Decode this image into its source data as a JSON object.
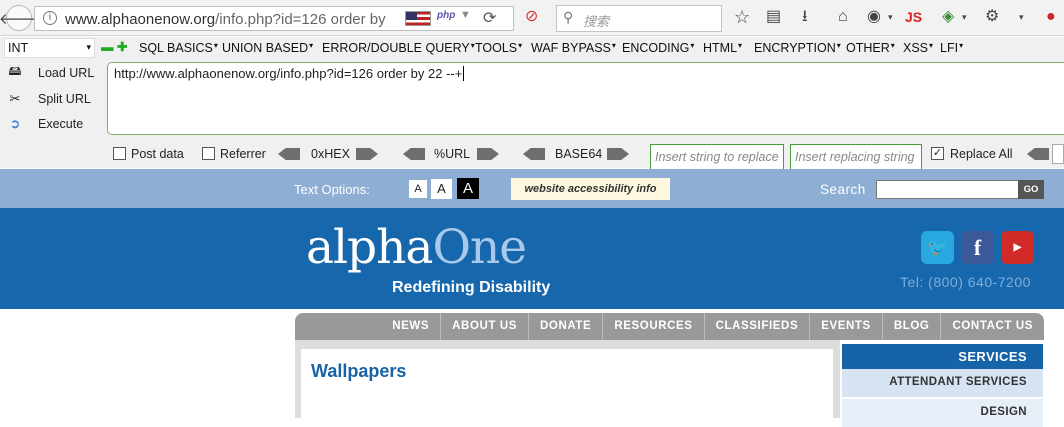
{
  "browser": {
    "url_domain": "www.alphaonenow.org",
    "url_rest": "/info.php?id=126 order by",
    "search_placeholder": "搜索",
    "js_label": "JS"
  },
  "hackbar": {
    "int_select": "INT",
    "menus": [
      "SQL BASICS",
      "UNION BASED",
      "ERROR/DOUBLE QUERY",
      "TOOLS",
      "WAF BYPASS",
      "ENCODING",
      "HTML",
      "ENCRYPTION",
      "OTHER",
      "XSS",
      "LFI"
    ],
    "load_url": "Load URL",
    "split_url": "Split URL",
    "execute": "Execute",
    "url_value": "http://www.alphaonenow.org/info.php?id=126 order by 22 --+",
    "post_data": "Post data",
    "referrer": "Referrer",
    "hex": "0xHEX",
    "url_enc": "%URL",
    "base64": "BASE64",
    "insert_replace": "Insert string to replace",
    "insert_replacing": "Insert replacing string",
    "replace_all": "Replace All"
  },
  "site": {
    "text_options": "Text Options:",
    "size_small": "A",
    "size_medium": "A",
    "size_large": "A",
    "accessibility": "website accessibility info",
    "search_label": "Search",
    "go": "GO",
    "logo_alpha": "alpha",
    "logo_one": "One",
    "tagline": "Redefining Disability",
    "tel": "Tel: (800) 640-7200",
    "nav": [
      "NEWS",
      "ABOUT US",
      "DONATE",
      "RESOURCES",
      "CLASSIFIEDS",
      "EVENTS",
      "BLOG",
      "CONTACT US"
    ],
    "heading": "Wallpapers",
    "services_title": "SERVICES",
    "services": [
      "ATTENDANT SERVICES",
      "DESIGN"
    ]
  },
  "colors": {
    "header_blue": "#1767ac",
    "band_blue": "#8eaed3",
    "twitter": "#29a8e0",
    "facebook": "#3b5998",
    "youtube": "#d12b27"
  }
}
